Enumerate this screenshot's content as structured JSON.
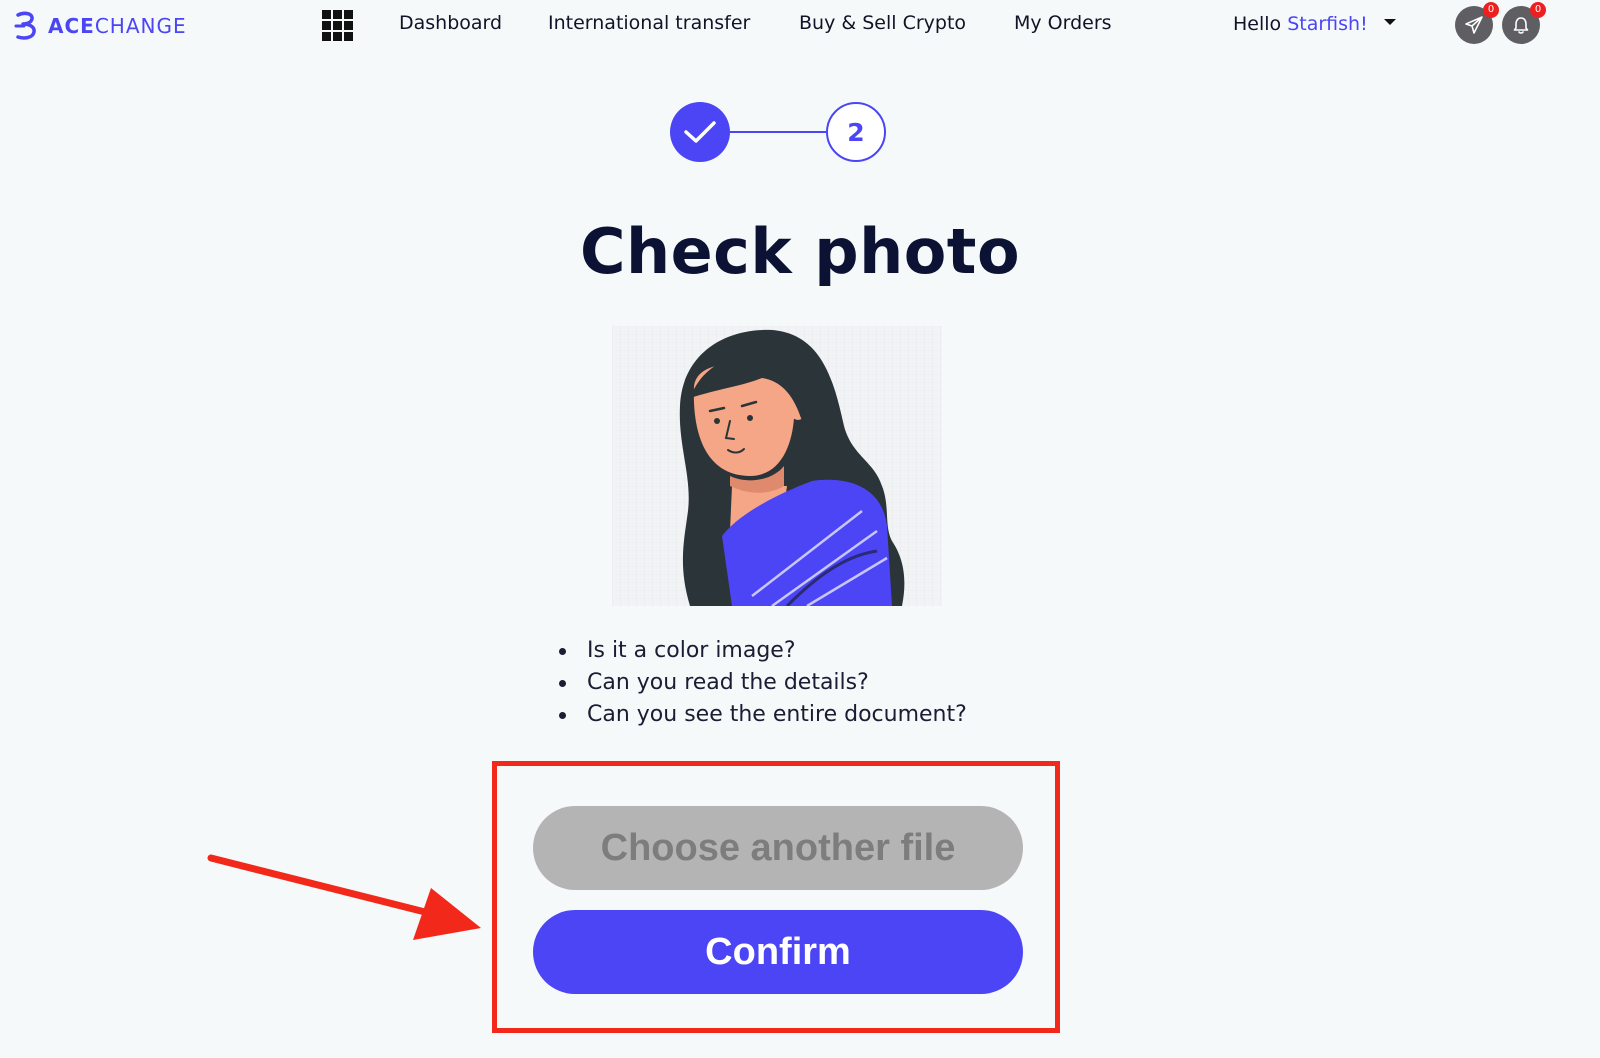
{
  "header": {
    "logo_prefix": "ACE",
    "logo_suffix": "CHANGE",
    "apps_icon": "grid-icon",
    "nav": [
      {
        "label": "Dashboard"
      },
      {
        "label": "International transfer"
      },
      {
        "label": "Buy & Sell Crypto"
      },
      {
        "label": "My Orders"
      }
    ],
    "greeting": "Hello",
    "username": "Starfish!",
    "messages_badge": "0",
    "notifications_badge": "0"
  },
  "stepper": {
    "step1_icon": "checkmark-icon",
    "step2_label": "2"
  },
  "main": {
    "title": "Check photo",
    "checklist": [
      "Is it a color image?",
      "Can you read the details?",
      "Can you see the entire document?"
    ],
    "secondary_button": "Choose another file",
    "primary_button": "Confirm"
  },
  "colors": {
    "accent": "#4b45f5",
    "annotation": "#f2281b",
    "secondary_button": "#b4b4b4"
  }
}
